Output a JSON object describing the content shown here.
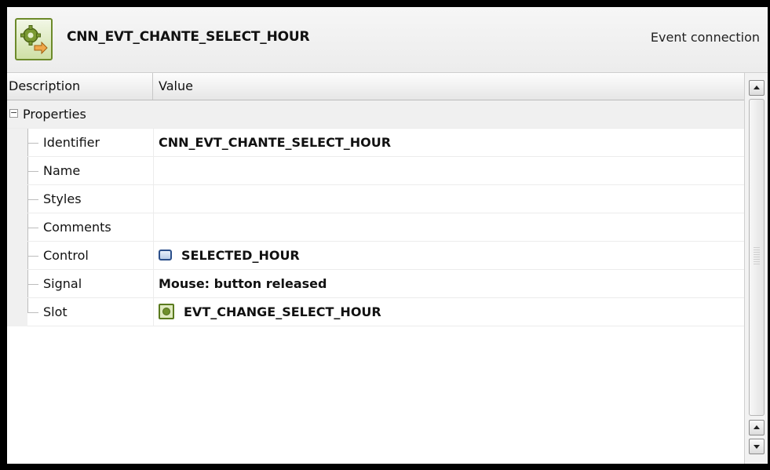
{
  "header": {
    "icon": "event-connection-gear-icon",
    "title": "CNN_EVT_CHANTE_SELECT_HOUR",
    "kind": "Event connection"
  },
  "columns": {
    "description": "Description",
    "value": "Value"
  },
  "group": {
    "label": "Properties",
    "expanded_symbol": "−"
  },
  "properties": [
    {
      "name": "Identifier",
      "value": "CNN_EVT_CHANTE_SELECT_HOUR"
    },
    {
      "name": "Name",
      "value": ""
    },
    {
      "name": "Styles",
      "value": ""
    },
    {
      "name": "Comments",
      "value": ""
    },
    {
      "name": "Control",
      "value": "SELECTED_HOUR",
      "icon": "control-icon"
    },
    {
      "name": "Signal",
      "value": "Mouse: button released"
    },
    {
      "name": "Slot",
      "value": "EVT_CHANGE_SELECT_HOUR",
      "icon": "slot-icon"
    }
  ],
  "colors": {
    "header_icon_border": "#6c8a2a",
    "control_icon": "#2b4f8a",
    "slot_icon": "#5a7a1e"
  }
}
